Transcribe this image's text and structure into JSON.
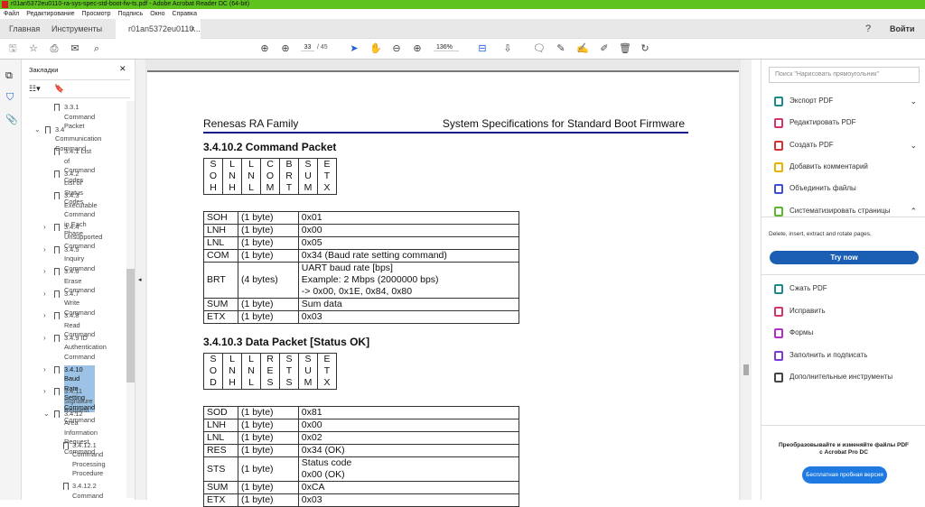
{
  "window": {
    "title": "r01an5372eu0110-ra-sys-spec-std-boot-fw-ts.pdf - Adobe Acrobat Reader DC (64-bit)"
  },
  "menu": [
    "Файл",
    "Редактирование",
    "Просмотр",
    "Подпись",
    "Окно",
    "Справка"
  ],
  "tabs": {
    "home": "Главная",
    "tools": "Инструменты",
    "doc": "r01an5372eu0110...",
    "close": "×",
    "signin": "Войти"
  },
  "toolbar": {
    "page_current": "33",
    "page_sep": "/",
    "page_total": "45",
    "zoom": "136%"
  },
  "bookmarks": {
    "title": "Закладки",
    "close": "✕",
    "items": [
      {
        "label": "3.3.1 Command\nPacket",
        "level": 2,
        "expand": ""
      },
      {
        "label": "3.4 Communication\nCommand",
        "level": 1,
        "expand": "⌄"
      },
      {
        "label": "3.4.1 List of\nCommand Codes",
        "level": 2,
        "expand": ""
      },
      {
        "label": "3.4.2 List of Status\nCodes",
        "level": 2,
        "expand": ""
      },
      {
        "label": "3.4.3 Executable\nCommand in Each\nPhase",
        "level": 2,
        "expand": ""
      },
      {
        "label": "3.4.4 Unsupported\nCommand",
        "level": 2,
        "expand": "›"
      },
      {
        "label": "3.4.5 Inquiry\nCommand",
        "level": 2,
        "expand": "›"
      },
      {
        "label": "3.4.6 Erase\nCommand",
        "level": 2,
        "expand": "›"
      },
      {
        "label": "3.4.7 Write\nCommand",
        "level": 2,
        "expand": "›"
      },
      {
        "label": "3.4.8 Read\nCommand",
        "level": 2,
        "expand": "›"
      },
      {
        "label": "3.4.9 ID\nAuthentication\nCommand",
        "level": 2,
        "expand": "›"
      },
      {
        "label": "3.4.10 Baud Rate\nSetting Command",
        "level": 2,
        "expand": "›",
        "selected": true
      },
      {
        "label": "3.4.11 Signature\nRequest Command",
        "level": 2,
        "expand": "›"
      },
      {
        "label": "3.4.12 Area\nInformation\nRequest Command",
        "level": 2,
        "expand": "⌄"
      },
      {
        "label": "3.4.12.1\nCommand\nProcessing\nProcedure",
        "level": 3,
        "expand": ""
      },
      {
        "label": "3.4.12.2\nCommand",
        "level": 3,
        "expand": ""
      }
    ]
  },
  "document": {
    "header_left": "Renesas RA Family",
    "header_right": "System Specifications for Standard Boot Firmware",
    "sec1": "3.4.10.2 Command Packet",
    "fmt1": [
      [
        "S\nO\nH"
      ],
      [
        "L\nN\nH"
      ],
      [
        "L\nN\nL"
      ],
      [
        "C\nO\nM"
      ],
      [
        "B\nR\nT"
      ],
      [
        "S\nU\nM"
      ],
      [
        "E\nT\nX"
      ]
    ],
    "table1": [
      [
        "SOH",
        "(1 byte)",
        "0x01"
      ],
      [
        "LNH",
        "(1 byte)",
        "0x00"
      ],
      [
        "LNL",
        "(1 byte)",
        "0x05"
      ],
      [
        "COM",
        "(1 byte)",
        "0x34 (Baud rate setting command)"
      ],
      [
        "BRT",
        "(4 bytes)",
        "UART baud rate [bps]\nExample: 2 Mbps (2000000 bps)\n-> 0x00, 0x1E, 0x84, 0x80"
      ],
      [
        "SUM",
        "(1 byte)",
        "Sum data"
      ],
      [
        "ETX",
        "(1 byte)",
        "0x03"
      ]
    ],
    "sec2": "3.4.10.3 Data Packet [Status OK]",
    "fmt2": [
      [
        "S\nO\nD"
      ],
      [
        "L\nN\nH"
      ],
      [
        "L\nN\nL"
      ],
      [
        "R\nE\nS"
      ],
      [
        "S\nT\nS"
      ],
      [
        "S\nU\nM"
      ],
      [
        "E\nT\nX"
      ]
    ],
    "table2": [
      [
        "SOD",
        "(1 byte)",
        "0x81"
      ],
      [
        "LNH",
        "(1 byte)",
        "0x00"
      ],
      [
        "LNL",
        "(1 byte)",
        "0x02"
      ],
      [
        "RES",
        "(1 byte)",
        "0x34 (OK)"
      ],
      [
        "STS",
        "(1 byte)",
        "Status code\n0x00 (OK)"
      ],
      [
        "SUM",
        "(1 byte)",
        "0xCA"
      ],
      [
        "ETX",
        "(1 byte)",
        "0x03"
      ]
    ]
  },
  "rightpane": {
    "search_placeholder": "Поиск \"Нарисовать прямоугольник\"",
    "tools": [
      {
        "label": "Экспорт PDF",
        "color": "#1b8a8a",
        "chev": "⌄"
      },
      {
        "label": "Редактировать PDF",
        "color": "#d6336c",
        "chev": ""
      },
      {
        "label": "Создать PDF",
        "color": "#d92f2f",
        "chev": "⌄"
      },
      {
        "label": "Добавить комментарий",
        "color": "#e8b400",
        "chev": ""
      },
      {
        "label": "Объединить файлы",
        "color": "#3b4fd8",
        "chev": ""
      },
      {
        "label": "Систематизировать страницы",
        "color": "#5cb82e",
        "chev": "⌃"
      }
    ],
    "organize_desc": "Delete, insert, extract and rotate pages.",
    "try_now": "Try now",
    "tools2": [
      {
        "label": "Сжать PDF",
        "color": "#1b8a8a"
      },
      {
        "label": "Исправить",
        "color": "#d6336c"
      },
      {
        "label": "Формы",
        "color": "#b02fc4"
      },
      {
        "label": "Заполнить и подписать",
        "color": "#7a3bd8"
      },
      {
        "label": "Дополнительные инструменты",
        "color": "#444444"
      }
    ],
    "promo": "Преобразовывайте и изменяйте файлы PDF\nс Acrobat Pro DC",
    "trial": "Бесплатная пробная версия"
  }
}
